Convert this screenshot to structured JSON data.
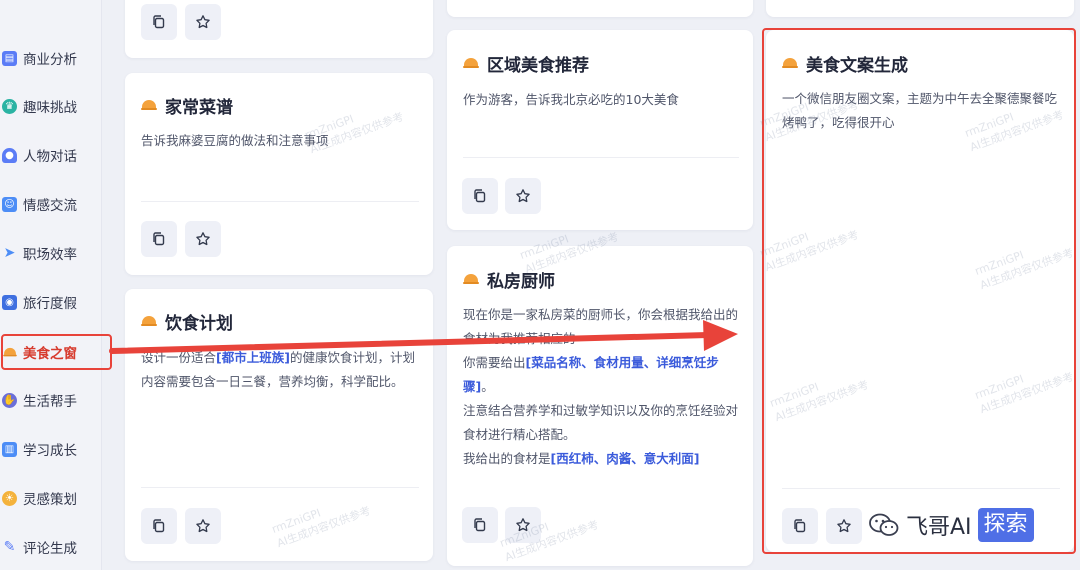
{
  "sidebar": {
    "items": [
      {
        "label": "商业分析",
        "icon": "chart-icon",
        "color": "#5b7cf6"
      },
      {
        "label": "趣味挑战",
        "icon": "trophy-icon",
        "color": "#2bb3a3"
      },
      {
        "label": "人物对话",
        "icon": "person-icon",
        "color": "#5b7cf6"
      },
      {
        "label": "情感交流",
        "icon": "chat-icon",
        "color": "#4d8df6"
      },
      {
        "label": "职场效率",
        "icon": "paper-plane-icon",
        "color": "#4d8df6"
      },
      {
        "label": "旅行度假",
        "icon": "camera-icon",
        "color": "#3f6fe0"
      },
      {
        "label": "美食之窗",
        "icon": "dome-icon",
        "color": "#f4a23c"
      },
      {
        "label": "生活帮手",
        "icon": "hands-icon",
        "color": "#6b6fd8"
      },
      {
        "label": "学习成长",
        "icon": "book-icon",
        "color": "#4d8df6"
      },
      {
        "label": "灵感策划",
        "icon": "lightbulb-icon",
        "color": "#f4b23c"
      },
      {
        "label": "评论生成",
        "icon": "pen-icon",
        "color": "#5b7cf6"
      }
    ]
  },
  "cards": {
    "home_recipe": {
      "title": "家常菜谱",
      "desc": "告诉我麻婆豆腐的做法和注意事项"
    },
    "diet_plan": {
      "title": "饮食计划",
      "desc_a": "设计一份适合",
      "desc_hl": "[都市上班族]",
      "desc_b": "的健康饮食计划，计划内容需要包含一日三餐，营养均衡，科学配比。"
    },
    "regional_food": {
      "title": "区域美食推荐",
      "desc": "作为游客，告诉我北京必吃的10大美食"
    },
    "private_chef": {
      "title": "私房厨师",
      "line1": "现在你是一家私房菜的厨师长，你会根据我给出的食材为我推荐相应的",
      "line2_a": "你需要给出",
      "line2_hl": "[菜品名称、食材用量、详细烹饪步骤]",
      "line2_b": "。",
      "line3": "注意结合营养学和过敏学知识以及你的烹饪经验对食材进行精心搭配。",
      "line4_a": "我给出的食材是",
      "line4_hl": "[西红柿、肉酱、意大利面]"
    },
    "food_copy": {
      "title": "美食文案生成",
      "desc": "一个微信朋友圈文案，主题为中午去全聚德聚餐吃烤鸭了，吃得很开心"
    }
  },
  "watermark": {
    "line1": "rmZniGPI",
    "line2": "AI生成内容仅供参考"
  },
  "brand": {
    "text": "飞哥AI",
    "box": "探索"
  },
  "colors": {
    "accent": "#e8433a",
    "highlight": "#3b5bdb",
    "brand": "#4f6fe6"
  }
}
